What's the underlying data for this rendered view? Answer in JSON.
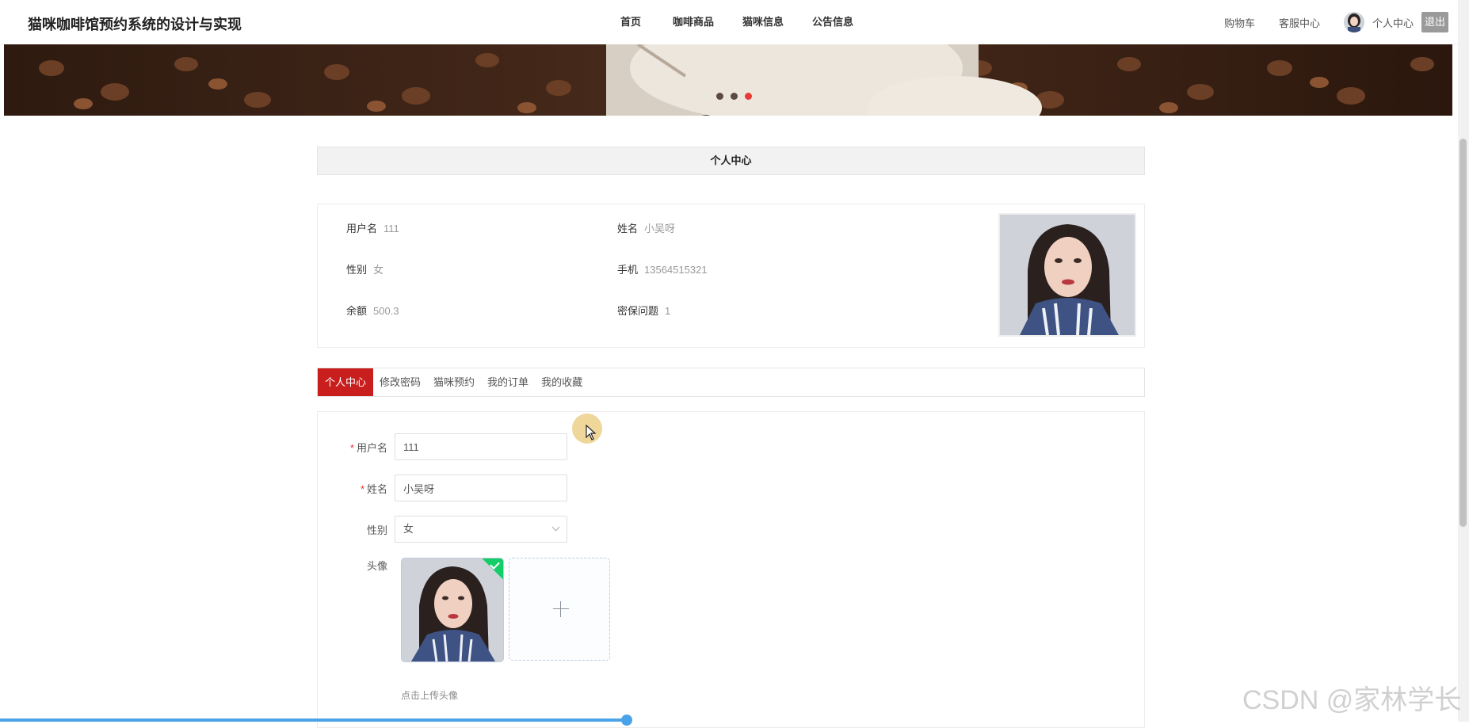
{
  "header": {
    "title": "猫咪咖啡馆预约系统的设计与实现",
    "nav": [
      "首页",
      "咖啡商品",
      "猫咪信息",
      "公告信息"
    ],
    "cart_label": "购物车",
    "service_label": "客服中心",
    "user_center_label": "个人中心",
    "logout_label": "退出"
  },
  "banner": {
    "slide_count": 3,
    "active_slide": 3
  },
  "profile": {
    "section_title": "个人中心",
    "fields": {
      "username": {
        "label": "用户名",
        "value": "111"
      },
      "name": {
        "label": "姓名",
        "value": "小吴呀"
      },
      "gender": {
        "label": "性别",
        "value": "女"
      },
      "phone": {
        "label": "手机",
        "value": "13564515321"
      },
      "balance": {
        "label": "余额",
        "value": "500.3"
      },
      "security_question": {
        "label": "密保问题",
        "value": "1"
      }
    }
  },
  "tabs": [
    "个人中心",
    "修改密码",
    "猫咪预约",
    "我的订单",
    "我的收藏"
  ],
  "active_tab": "个人中心",
  "form": {
    "required_mark": "*",
    "username": {
      "label": "用户名",
      "value": "111"
    },
    "name": {
      "label": "姓名",
      "value": "小吴呀"
    },
    "gender": {
      "label": "性别",
      "value": "女"
    },
    "avatar": {
      "label": "头像",
      "hint": "点击上传头像"
    }
  },
  "watermark": "CSDN @家林学长",
  "colors": {
    "accent_red": "#c81e1e",
    "active_dot": "#e63b36",
    "success_green": "#13ce66",
    "progress_blue": "#4aa3e8"
  },
  "icons": [
    "chevron-down-icon",
    "plus-icon",
    "check-icon",
    "cursor-icon"
  ]
}
